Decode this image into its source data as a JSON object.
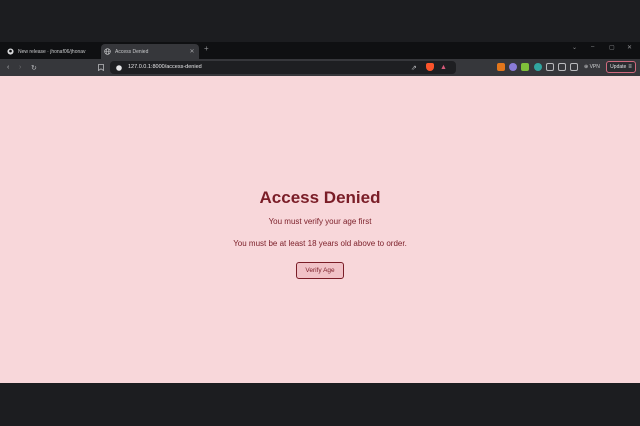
{
  "browser": {
    "tabs": [
      {
        "label": "New release · jhonaf06/jhonav",
        "active": false,
        "icon": "github-icon"
      },
      {
        "label": "Access Denied",
        "active": true,
        "icon": "globe-icon"
      }
    ],
    "new_tab_symbol": "+",
    "close_symbol": "✕",
    "address": "127.0.0.1:8000/access-denied",
    "vpn_label": "VPN",
    "update_label": "Update"
  },
  "page": {
    "heading": "Access Denied",
    "message_primary": "You must verify your age first",
    "message_secondary": "You must be at least 18 years old above to order.",
    "verify_button_label": "Verify Age"
  },
  "colors": {
    "page_background": "#f8d7da",
    "accent_text": "#7a1d27",
    "button_fill": "#f1c2c7"
  }
}
